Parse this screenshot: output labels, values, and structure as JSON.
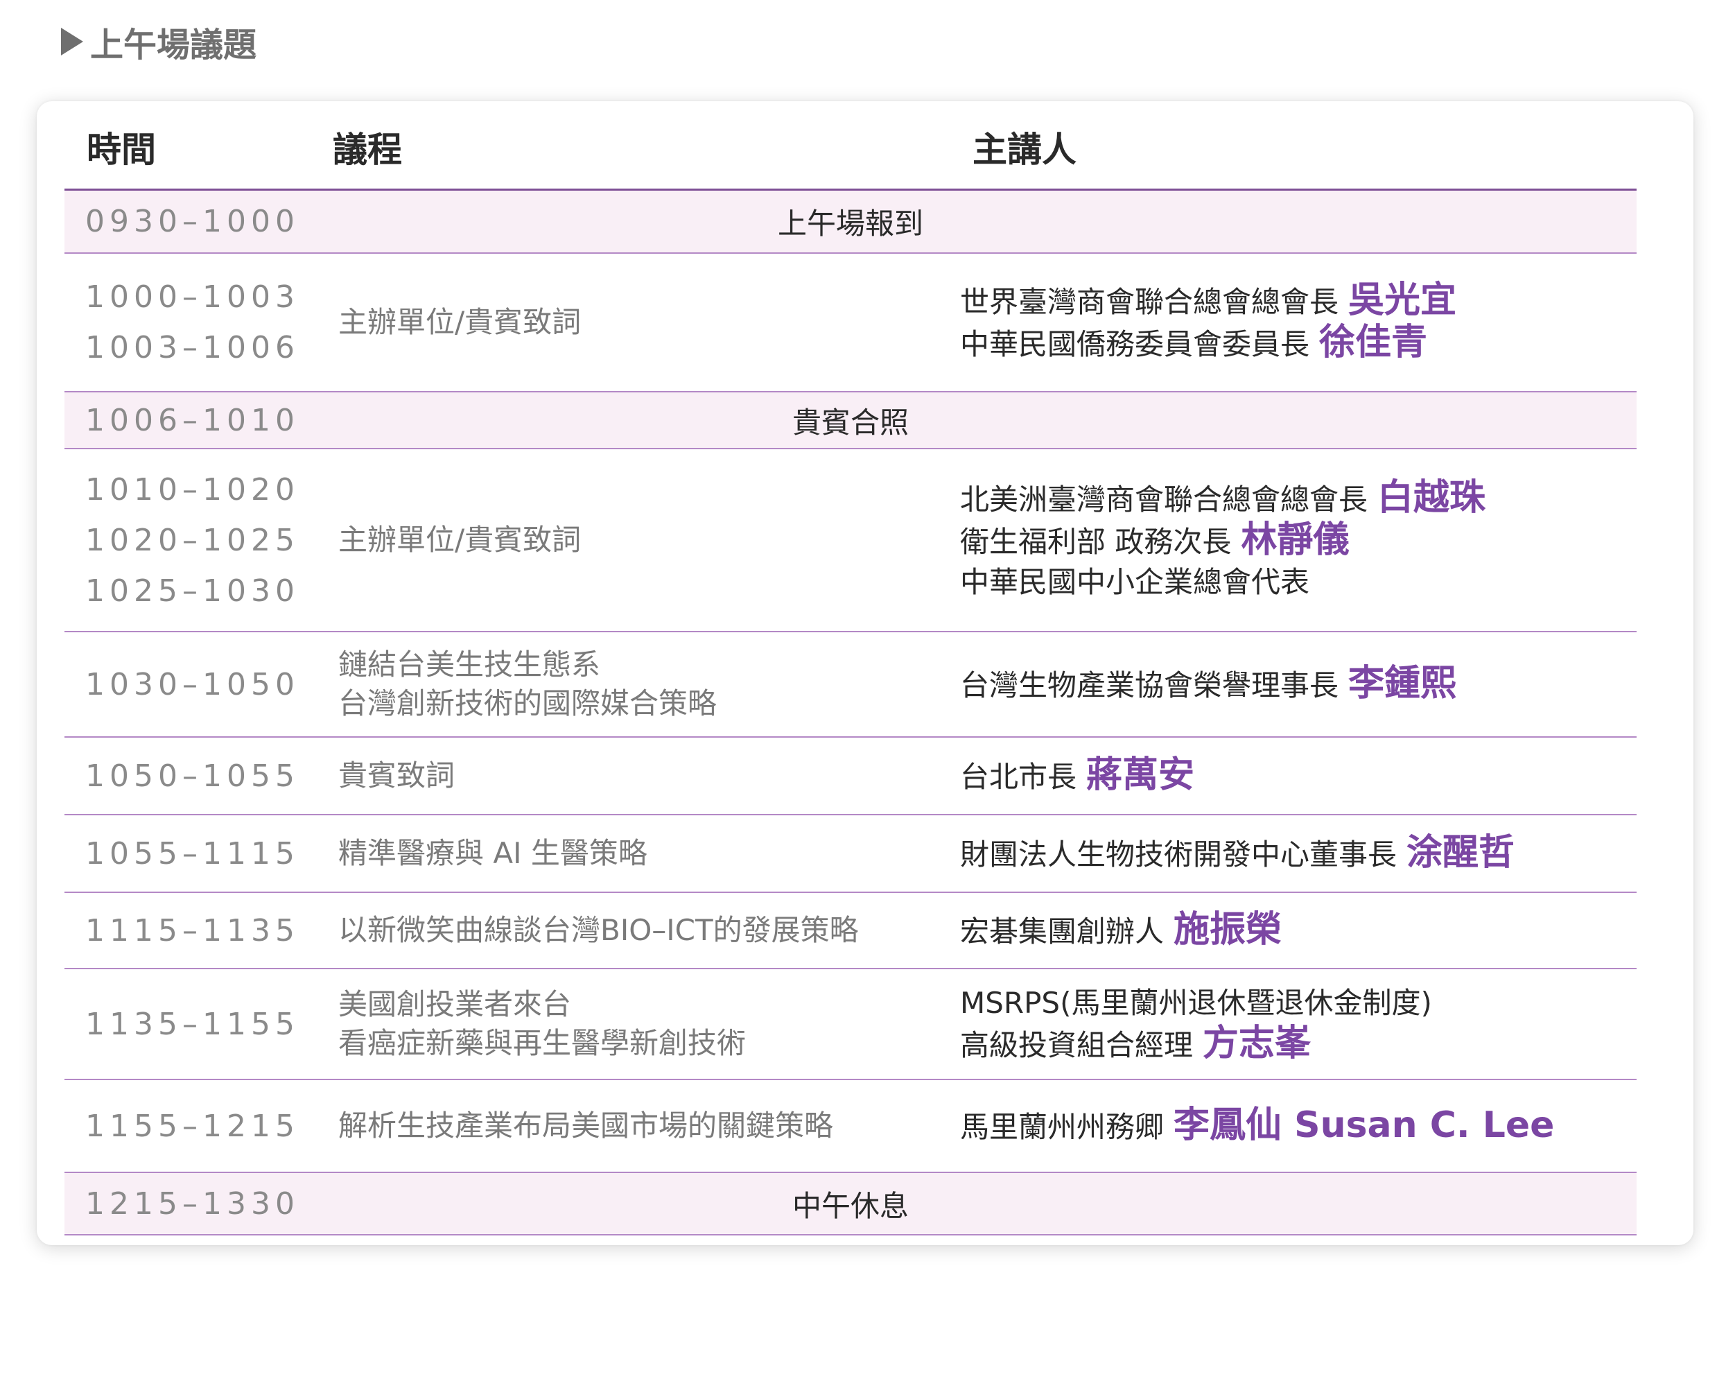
{
  "section_title": "上午場議題",
  "table": {
    "headers": {
      "time": "時間",
      "agenda": "議程",
      "speaker": "主講人"
    },
    "rows": [
      {
        "type": "full",
        "times": [
          "0930–1000"
        ],
        "label": "上午場報到"
      },
      {
        "type": "normal",
        "times": [
          "1000–1003",
          "1003–1006"
        ],
        "agenda": [
          "主辦單位/貴賓致詞"
        ],
        "speakers": [
          {
            "title": "世界臺灣商會聯合總會總會長",
            "name": "吳光宜"
          },
          {
            "title": "中華民國僑務委員會委員長",
            "name": "徐佳青"
          }
        ]
      },
      {
        "type": "full",
        "times": [
          "1006–1010"
        ],
        "label": "貴賓合照"
      },
      {
        "type": "normal",
        "times": [
          "1010–1020",
          "1020–1025",
          "1025–1030"
        ],
        "agenda": [
          "主辦單位/貴賓致詞"
        ],
        "speakers": [
          {
            "title": "北美洲臺灣商會聯合總會總會長",
            "name": "白越珠"
          },
          {
            "title": "衛生福利部 政務次長",
            "name": "林靜儀"
          },
          {
            "title": "中華民國中小企業總會代表",
            "name": ""
          }
        ]
      },
      {
        "type": "normal",
        "times": [
          "1030–1050"
        ],
        "agenda": [
          "鏈結台美生技生態系",
          "台灣創新技術的國際媒合策略"
        ],
        "speakers": [
          {
            "title": "台灣生物產業協會榮譽理事長",
            "name": "李鍾熙"
          }
        ]
      },
      {
        "type": "normal",
        "times": [
          "1050–1055"
        ],
        "agenda": [
          "貴賓致詞"
        ],
        "speakers": [
          {
            "title": "台北市長",
            "name": "蔣萬安"
          }
        ]
      },
      {
        "type": "normal",
        "times": [
          "1055–1115"
        ],
        "agenda": [
          "精準醫療與 AI 生醫策略"
        ],
        "speakers": [
          {
            "title": "財團法人生物技術開發中心董事長",
            "name": "涂醒哲"
          }
        ]
      },
      {
        "type": "normal",
        "times": [
          "1115–1135"
        ],
        "agenda": [
          "以新微笑曲線談台灣BIO–ICT的發展策略"
        ],
        "speakers": [
          {
            "title": "宏碁集團創辦人",
            "name": "施振榮"
          }
        ]
      },
      {
        "type": "normal",
        "times": [
          "1135–1155"
        ],
        "agenda": [
          "美國創投業者來台",
          "看癌症新藥與再生醫學新創技術"
        ],
        "speakers": [
          {
            "title": "MSRPS(馬里蘭州退休暨退休金制度)",
            "name": ""
          },
          {
            "title": "高級投資組合經理",
            "name": "方志峯"
          }
        ]
      },
      {
        "type": "normal",
        "times": [
          "1155–1215"
        ],
        "agenda": [
          "解析生技產業布局美國市場的關鍵策略"
        ],
        "speakers": [
          {
            "title": "馬里蘭州州務卿",
            "name": "李鳳仙 Susan C. Lee"
          }
        ]
      },
      {
        "type": "full",
        "times": [
          "1215–1330"
        ],
        "label": "中午休息"
      }
    ]
  }
}
